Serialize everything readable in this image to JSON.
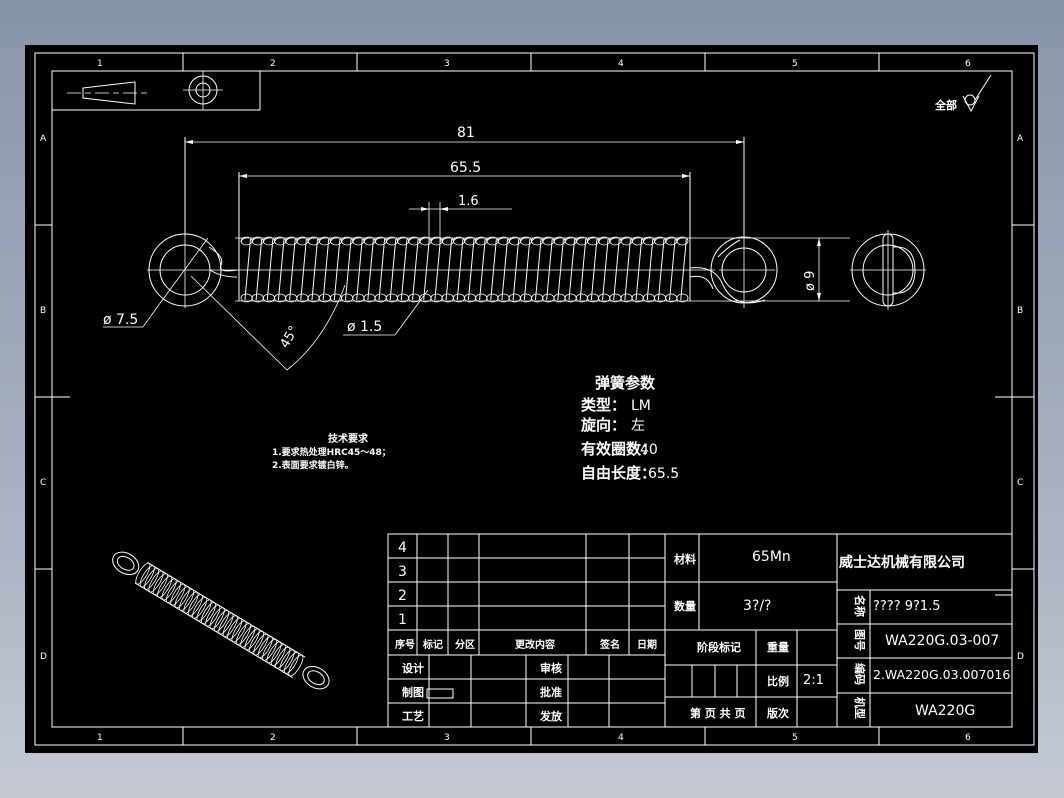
{
  "drawing": {
    "background": "#000000",
    "line_color": "#ffffff",
    "grid": {
      "columns": [
        "1",
        "2",
        "3",
        "4",
        "5",
        "6"
      ],
      "rows": [
        "A",
        "B",
        "C",
        "D"
      ]
    },
    "surface_finish": {
      "label": "全部",
      "symbol": "surface-roughness-check"
    },
    "dimensions": {
      "overall_length": "81",
      "body_length": "65.5",
      "pitch": "1.6",
      "outer_diameter": "ø 9",
      "hook_diameter": "ø 7.5",
      "wire_diameter": "ø 1.5",
      "hook_angle": "45°"
    },
    "spring_params": {
      "title": "弹簧参数",
      "lines": [
        {
          "label": "类型：",
          "value": "LM"
        },
        {
          "label": "旋向：",
          "value": "左"
        },
        {
          "label": "有效圈数：",
          "value": "40"
        },
        {
          "label": "自由长度：",
          "value": "65.5"
        }
      ]
    },
    "tech_requirements": {
      "title": "技术要求",
      "items": [
        "1.要求热处理HRC45～48；",
        "2.表面要求镀白锌。"
      ]
    }
  },
  "title_block": {
    "revision_rows": [
      "4",
      "3",
      "2",
      "1"
    ],
    "revision_headers": [
      "序号",
      "标记",
      "分区",
      "更改内容",
      "签名",
      "日期"
    ],
    "sign_labels": {
      "design": "设计",
      "drafting": "制图",
      "process": "工艺",
      "review": "审核",
      "approve": "批准",
      "release": "发放"
    },
    "material_label": "材料",
    "material_value": "65Mn",
    "quantity_label": "数量",
    "quantity_value": "3?/?",
    "stage_mark_label": "阶段标记",
    "weight_label": "重量",
    "weight_value": "",
    "scale_label": "比例",
    "scale_value": "2:1",
    "sheet_label": "第 页 共 页",
    "version_label": "版次",
    "company": "威士达机械有限公司",
    "name_label": "名称",
    "name_value": "???? 9?1.5",
    "drawing_no_label": "图号",
    "drawing_no_value": "WA220G.03-007",
    "code_label": "编码",
    "code_value": "2.WA220G.03.007016",
    "model_label": "机型",
    "model_value": "WA220G"
  }
}
